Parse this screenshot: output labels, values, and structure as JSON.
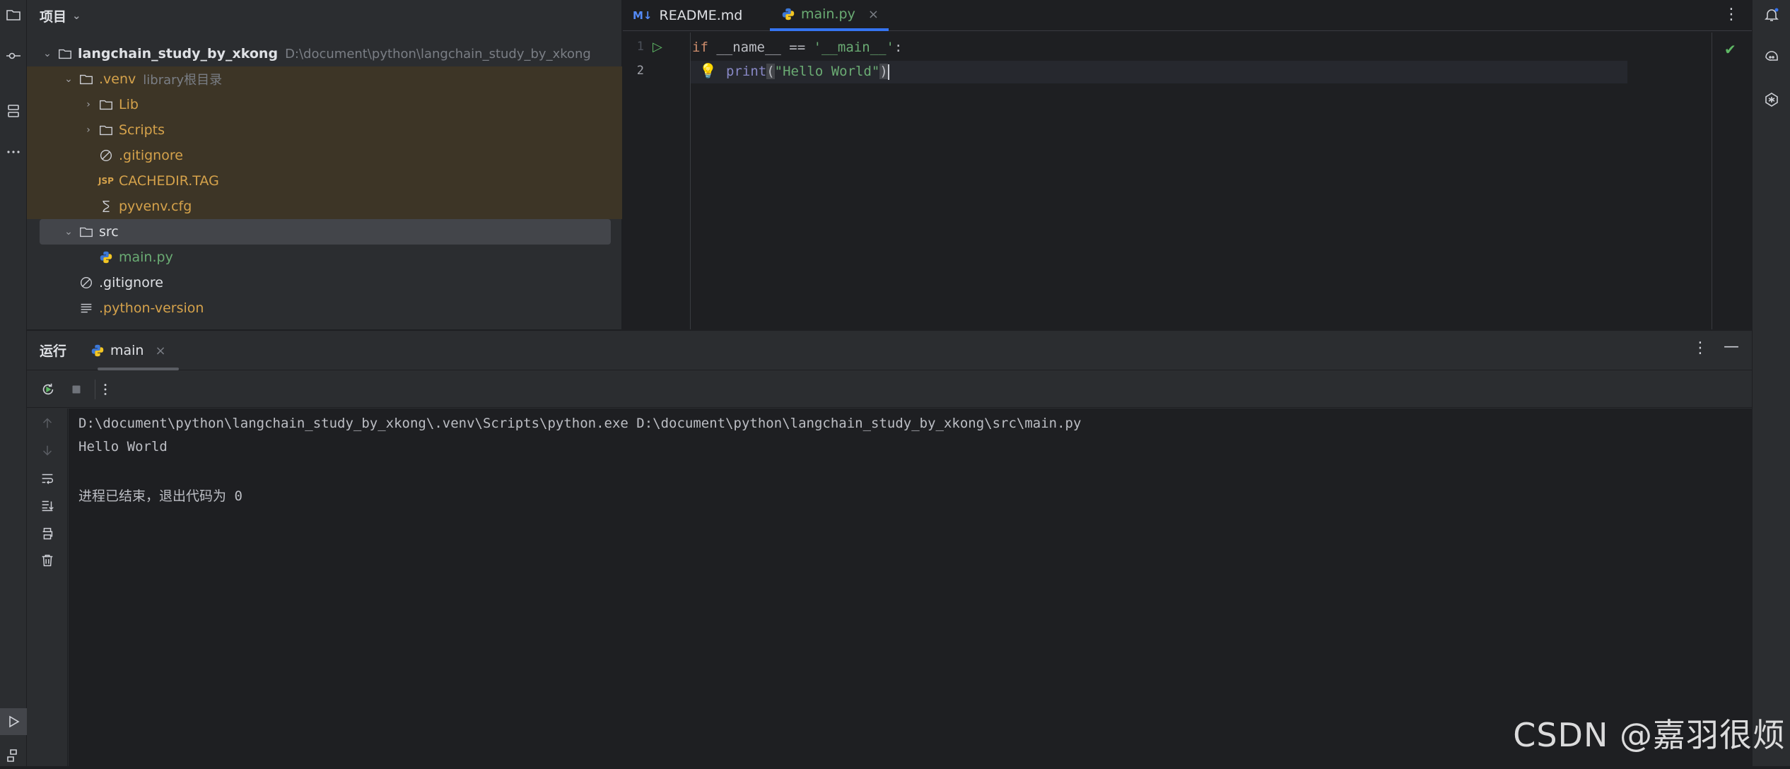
{
  "project_panel": {
    "title": "项目",
    "tree": [
      {
        "name": "langchain_study_by_xkong",
        "hint": "D:\\document\\python\\langchain_study_by_xkong"
      },
      {
        "name": ".venv",
        "hint": "library根目录"
      },
      {
        "name": "Lib"
      },
      {
        "name": "Scripts"
      },
      {
        "name": ".gitignore"
      },
      {
        "name": "CACHEDIR.TAG"
      },
      {
        "name": "pyvenv.cfg"
      },
      {
        "name": "src"
      },
      {
        "name": "main.py"
      },
      {
        "name": ".gitignore"
      },
      {
        "name": ".python-version"
      }
    ]
  },
  "editor": {
    "tabs": [
      {
        "badge": "M↓",
        "label": "README.md"
      },
      {
        "label": "main.py"
      }
    ],
    "line_numbers": [
      "1",
      "2"
    ],
    "code": {
      "line1": {
        "kw": "if",
        "rest1": " __name__ == ",
        "str": "'__main__'",
        "rest2": ":"
      },
      "line2": {
        "fn": "print",
        "open": "(",
        "str": "\"Hello World\"",
        "close": ")"
      }
    }
  },
  "run_panel": {
    "title": "运行",
    "tab_label": "main",
    "console": [
      "D:\\document\\python\\langchain_study_by_xkong\\.venv\\Scripts\\python.exe D:\\document\\python\\langchain_study_by_xkong\\src\\main.py",
      "Hello World",
      "进程已结束，退出代码为 0"
    ]
  },
  "watermark": "CSDN @嘉羽很烦",
  "colors": {
    "accent": "#3574f0",
    "excluded_bg": "#3d3526",
    "orange": "#d5a24b",
    "green": "#6aab73"
  }
}
